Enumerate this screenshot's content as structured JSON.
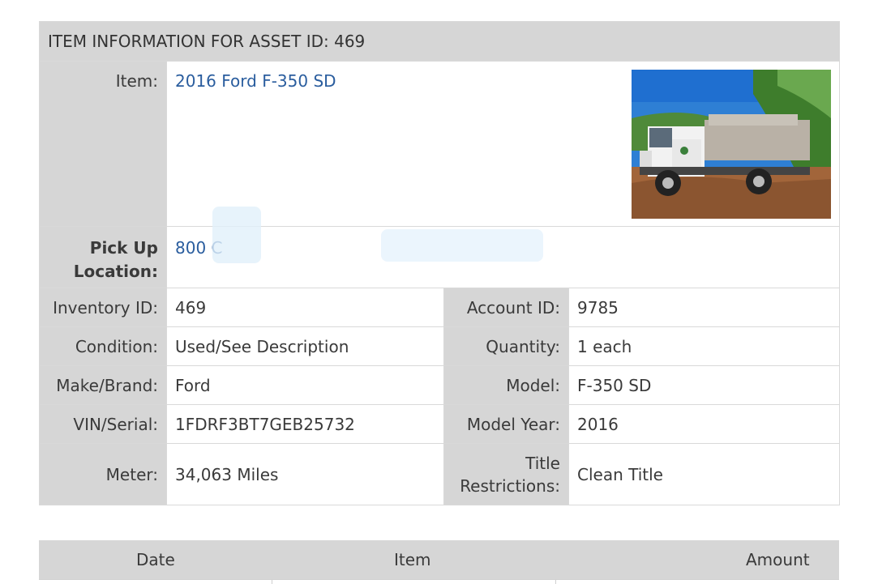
{
  "header": {
    "title": "ITEM INFORMATION FOR ASSET ID: 469"
  },
  "item": {
    "label": "Item:",
    "value": "2016 Ford F-350 SD",
    "image_alt": "photo of white utility truck with dump bed"
  },
  "pickup": {
    "label_line1": "Pick Up",
    "label_line2": "Location:",
    "value": "800 C"
  },
  "rows": [
    {
      "left_label": "Inventory ID:",
      "left_value": "469",
      "right_label": "Account ID:",
      "right_value": "9785"
    },
    {
      "left_label": "Condition:",
      "left_value": "Used/See Description",
      "right_label": "Quantity:",
      "right_value": "1 each"
    },
    {
      "left_label": "Make/Brand:",
      "left_value": "Ford",
      "right_label": "Model:",
      "right_value": "F-350 SD"
    },
    {
      "left_label": "VIN/Serial:",
      "left_value": "1FDRF3BT7GEB25732",
      "right_label": "Model Year:",
      "right_value": "2016"
    },
    {
      "left_label": "Meter:",
      "left_value": "34,063 Miles",
      "right_label_line1": "Title",
      "right_label_line2": "Restrictions:",
      "right_value": "Clean Title"
    }
  ],
  "transactions": {
    "headers": [
      "Date",
      "Item",
      "Amount"
    ]
  },
  "colors": {
    "header_bg": "#d6d6d6",
    "link": "#2a5d9e"
  }
}
